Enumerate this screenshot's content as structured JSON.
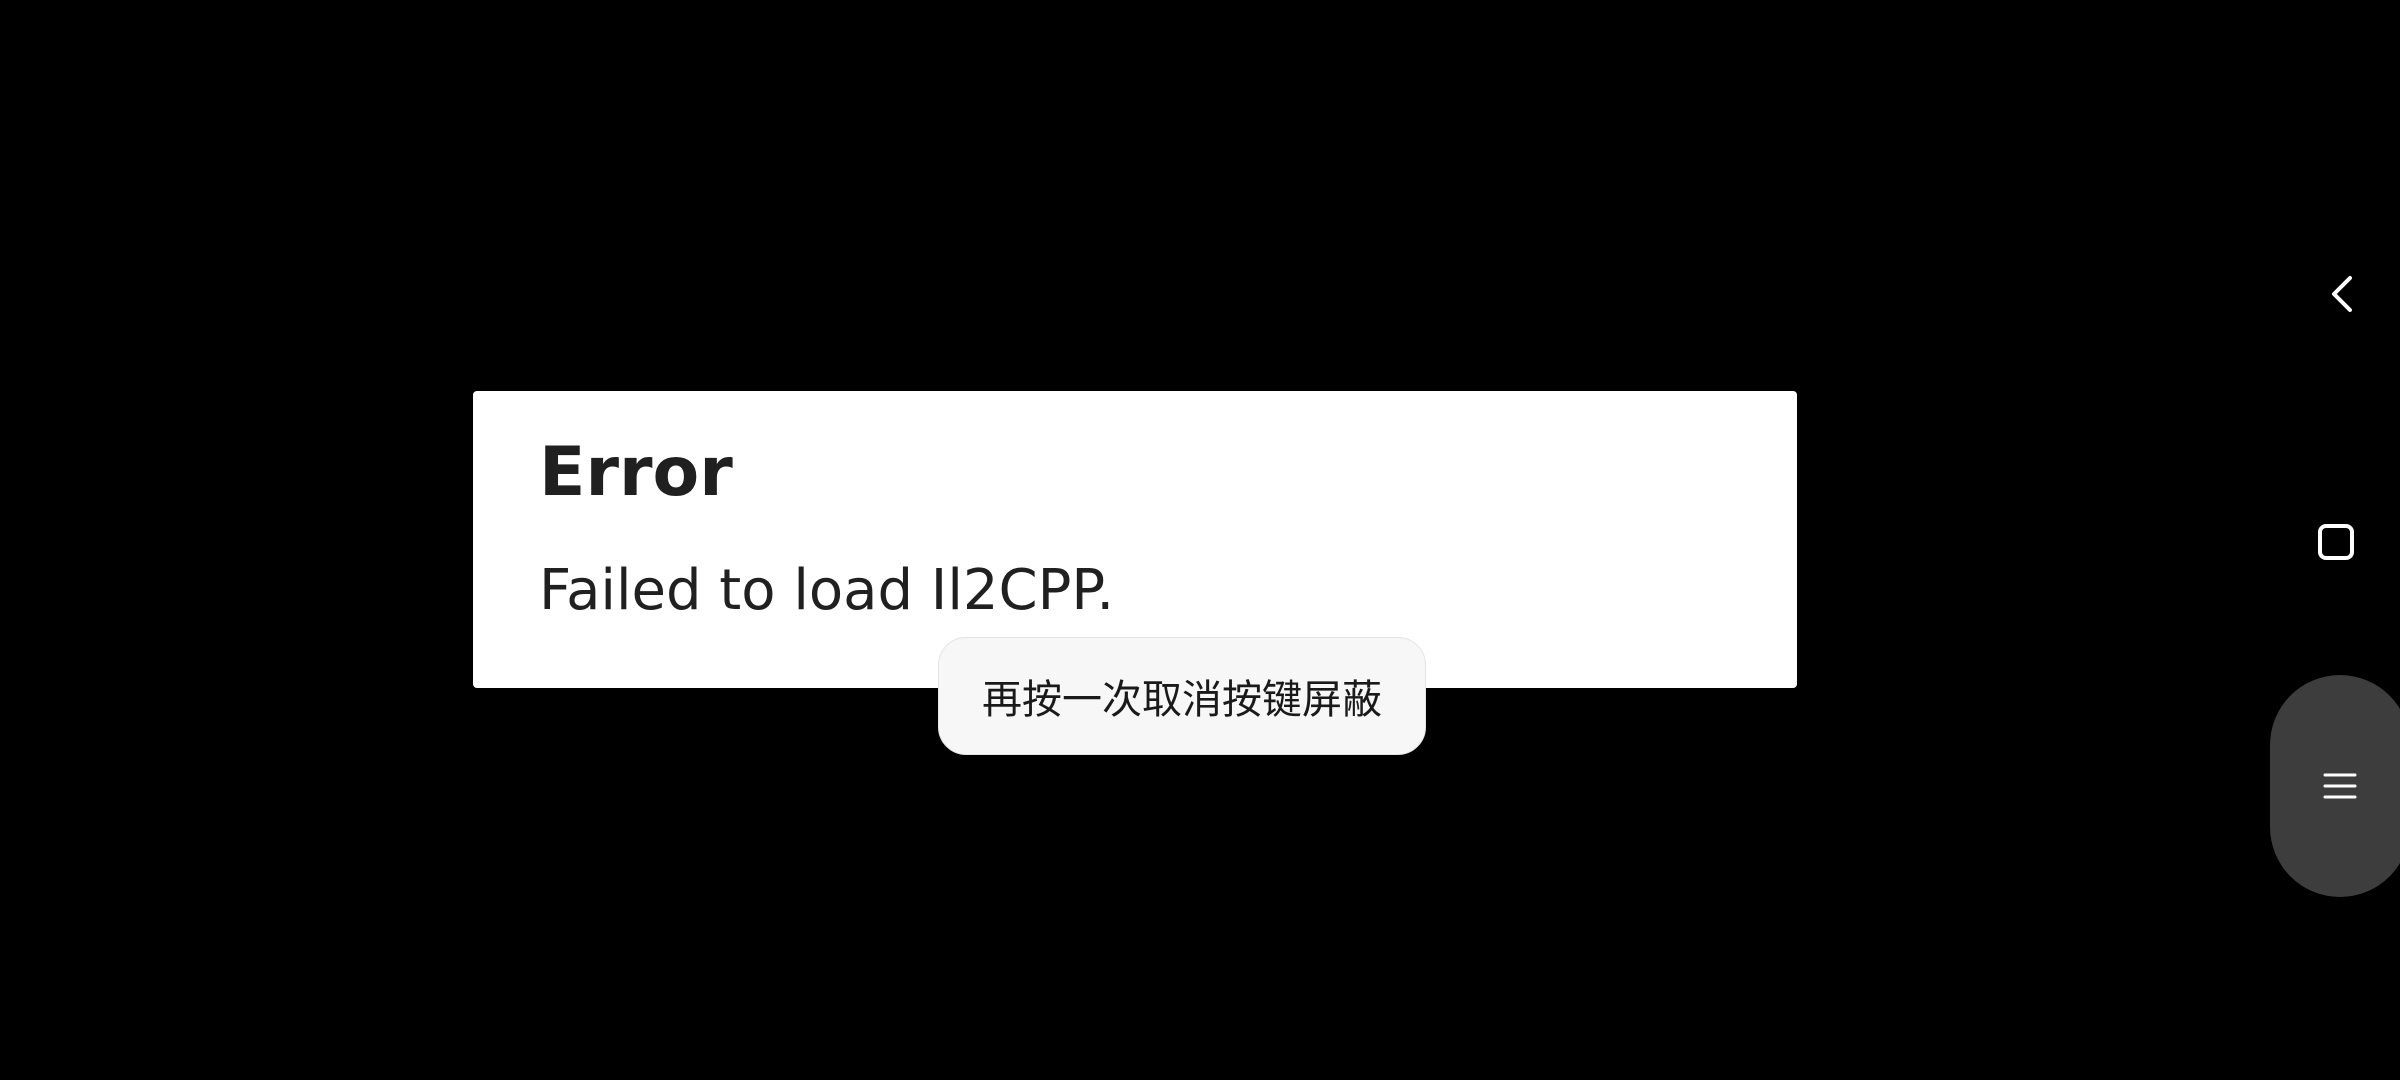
{
  "dialog": {
    "title": "Error",
    "message": "Failed to load Il2CPP."
  },
  "toast": {
    "text": "再按一次取消按键屏蔽"
  },
  "navigation": {
    "back_icon": "chevron-left-icon",
    "home_icon": "square-icon",
    "menu_icon": "hamburger-menu-icon"
  },
  "colors": {
    "background": "#000000",
    "dialog_background": "#ffffff",
    "text": "#202020",
    "toast_background": "#f7f7f7",
    "nav_pill": "#3d3d3d",
    "nav_icon": "#ffffff"
  }
}
